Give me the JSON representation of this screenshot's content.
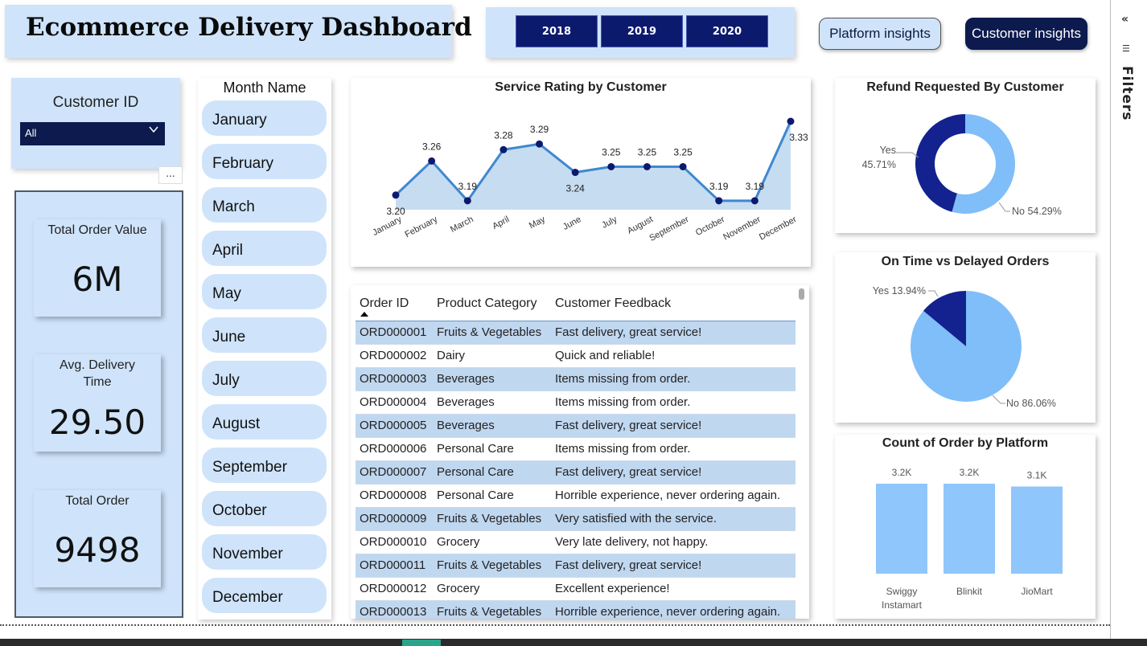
{
  "title": "Ecommerce Delivery Dashboard",
  "years": [
    "2018",
    "2019",
    "2020"
  ],
  "nav": {
    "platform": "Platform insights",
    "customer": "Customer insights"
  },
  "filters_label": "Filters",
  "customer_slicer": {
    "label": "Customer ID",
    "selected": "All"
  },
  "more_options": "...",
  "kpis": [
    {
      "label": "Total Order Value",
      "value": "6M"
    },
    {
      "label": "Avg. Delivery Time",
      "value": "29.50"
    },
    {
      "label": "Total Order",
      "value": "9498"
    }
  ],
  "month_slicer": {
    "title": "Month Name",
    "months": [
      "January",
      "February",
      "March",
      "April",
      "May",
      "June",
      "July",
      "August",
      "September",
      "October",
      "November",
      "December"
    ]
  },
  "table": {
    "columns": [
      "Order ID",
      "Product Category",
      "Customer Feedback"
    ],
    "rows": [
      [
        "ORD000001",
        "Fruits & Vegetables",
        "Fast delivery, great service!"
      ],
      [
        "ORD000002",
        "Dairy",
        "Quick and reliable!"
      ],
      [
        "ORD000003",
        "Beverages",
        "Items missing from order."
      ],
      [
        "ORD000004",
        "Beverages",
        "Items missing from order."
      ],
      [
        "ORD000005",
        "Beverages",
        "Fast delivery, great service!"
      ],
      [
        "ORD000006",
        "Personal Care",
        "Items missing from order."
      ],
      [
        "ORD000007",
        "Personal Care",
        "Fast delivery, great service!"
      ],
      [
        "ORD000008",
        "Personal Care",
        "Horrible experience, never ordering again."
      ],
      [
        "ORD000009",
        "Fruits & Vegetables",
        "Very satisfied with the service."
      ],
      [
        "ORD000010",
        "Grocery",
        "Very late delivery, not happy."
      ],
      [
        "ORD000011",
        "Fruits & Vegetables",
        "Fast delivery, great service!"
      ],
      [
        "ORD000012",
        "Grocery",
        "Excellent experience!"
      ],
      [
        "ORD000013",
        "Fruits & Vegetables",
        "Horrible experience, never ordering again."
      ]
    ]
  },
  "colors": {
    "navy": "#0c1a6e",
    "light_blue": "#cfe4fb",
    "chart_blue": "#3f88cf",
    "slice_light": "#7fbef9",
    "slice_dark": "#13228f"
  },
  "chart_data": [
    {
      "type": "area",
      "title": "Service Rating by Customer",
      "categories": [
        "January",
        "February",
        "March",
        "April",
        "May",
        "June",
        "July",
        "August",
        "September",
        "October",
        "November",
        "December"
      ],
      "values": [
        3.2,
        3.26,
        3.19,
        3.28,
        3.29,
        3.24,
        3.25,
        3.25,
        3.25,
        3.19,
        3.19,
        3.33
      ],
      "value_labels": [
        "3.20",
        "3.26",
        "3.19",
        "3.28",
        "3.29",
        "3.24",
        "3.25",
        "3.25",
        "3.25",
        "3.19",
        "3.19",
        "3.33"
      ],
      "ylim": [
        3.16,
        3.33
      ],
      "grid": false
    },
    {
      "type": "pie",
      "title": "Refund Requested By Customer",
      "donut": true,
      "slices": [
        {
          "label": "Yes",
          "value": 45.71,
          "label_text": "45.71%"
        },
        {
          "label": "No",
          "value": 54.29,
          "label_text": "No 54.29%"
        }
      ]
    },
    {
      "type": "pie",
      "title": "On Time vs Delayed Orders",
      "donut": false,
      "slices": [
        {
          "label": "Yes",
          "value": 13.94,
          "label_text": "Yes 13.94%"
        },
        {
          "label": "No",
          "value": 86.06,
          "label_text": "No 86.06%"
        }
      ]
    },
    {
      "type": "bar",
      "title": "Count of Order by Platform",
      "categories": [
        "Swiggy Instamart",
        "Blinkit",
        "JioMart"
      ],
      "values": [
        3.2,
        3.2,
        3.1
      ],
      "value_labels": [
        "3.2K",
        "3.2K",
        "3.1K"
      ],
      "ylim": [
        0,
        3.2
      ]
    }
  ]
}
